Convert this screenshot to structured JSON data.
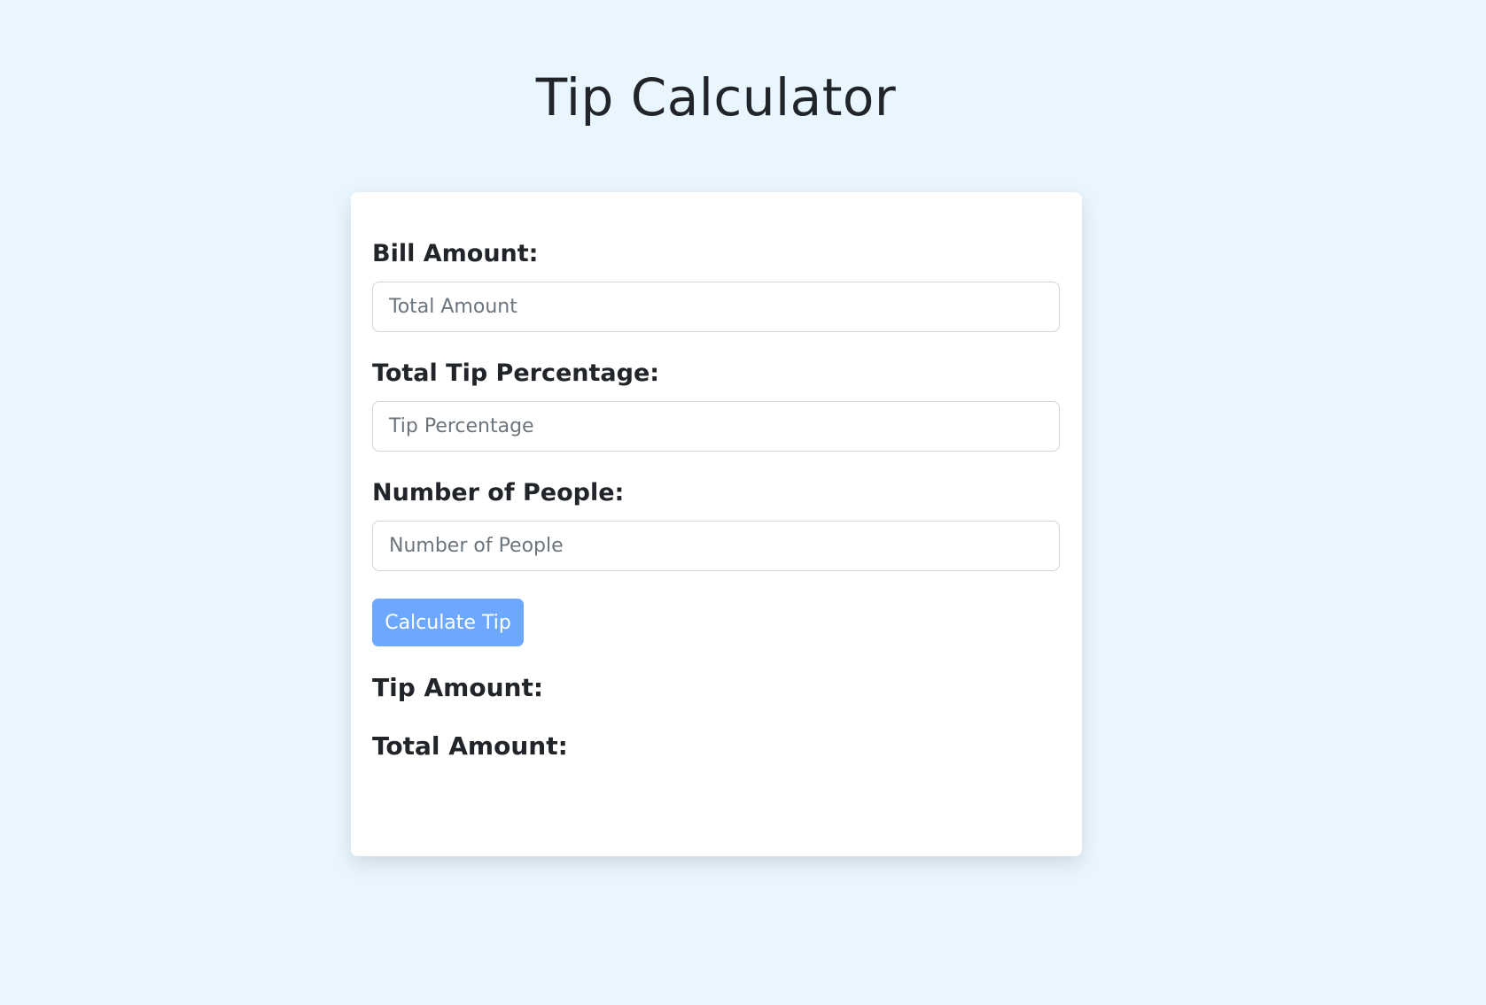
{
  "page": {
    "title": "Tip Calculator"
  },
  "form": {
    "bill": {
      "label": "Bill Amount:",
      "placeholder": "Total Amount",
      "value": ""
    },
    "tip_percentage": {
      "label": "Total Tip Percentage:",
      "placeholder": "Tip Percentage",
      "value": ""
    },
    "people": {
      "label": "Number of People:",
      "placeholder": "Number of People",
      "value": ""
    },
    "calculate_label": "Calculate Tip"
  },
  "results": {
    "tip_label": "Tip Amount:",
    "tip_value": "",
    "total_label": "Total Amount:",
    "total_value": ""
  },
  "colors": {
    "background": "#e9f6ff",
    "card": "#ffffff",
    "button": "#6ea8fe",
    "text": "#212529"
  }
}
